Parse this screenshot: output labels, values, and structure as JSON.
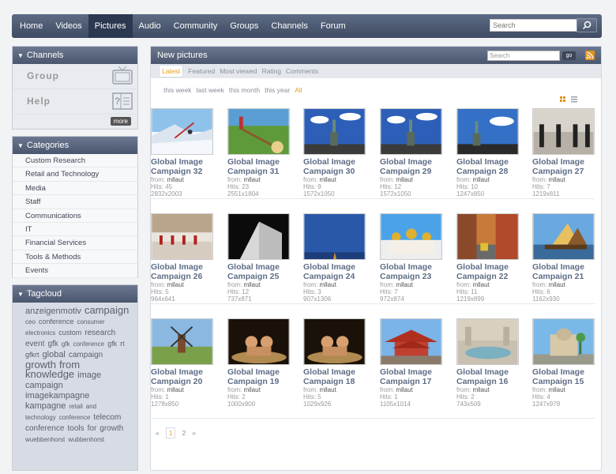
{
  "nav": {
    "items": [
      "Home",
      "Videos",
      "Pictures",
      "Audio",
      "Community",
      "Groups",
      "Channels",
      "Forum"
    ],
    "active": "Pictures",
    "search_placeholder": "Search"
  },
  "channels": {
    "title": "Channels",
    "items": [
      {
        "label": "Group",
        "icon": "tv-icon"
      },
      {
        "label": "Help",
        "icon": "help-icon"
      }
    ],
    "more_label": "more"
  },
  "categories": {
    "title": "Categories",
    "items": [
      "Custom Research",
      "Retail and Technology",
      "Media",
      "Staff",
      "Communications",
      "IT",
      "Financial Services",
      "Tools & Methods",
      "Events"
    ]
  },
  "tagcloud": {
    "title": "Tagcloud",
    "tags": [
      {
        "t": "anzeigenmotiv",
        "s": 11
      },
      {
        "t": "campaign",
        "s": 13
      },
      {
        "t": "ceo",
        "s": 8
      },
      {
        "t": "conference",
        "s": 9
      },
      {
        "t": "consumer",
        "s": 8
      },
      {
        "t": "electronics",
        "s": 8
      },
      {
        "t": "custom",
        "s": 9
      },
      {
        "t": "research",
        "s": 10
      },
      {
        "t": "event",
        "s": 10
      },
      {
        "t": "gfk",
        "s": 10
      },
      {
        "t": "gfk",
        "s": 8
      },
      {
        "t": "conference",
        "s": 8
      },
      {
        "t": "gfk",
        "s": 9
      },
      {
        "t": "rt",
        "s": 9
      },
      {
        "t": "gfkrt",
        "s": 9
      },
      {
        "t": "global",
        "s": 11
      },
      {
        "t": "campaign",
        "s": 10
      },
      {
        "t": "growth",
        "s": 13
      },
      {
        "t": "from",
        "s": 13
      },
      {
        "t": "knowledge",
        "s": 13
      },
      {
        "t": "image",
        "s": 11
      },
      {
        "t": "campaign",
        "s": 11
      },
      {
        "t": "imagekampagne",
        "s": 11
      },
      {
        "t": "kampagne",
        "s": 11
      },
      {
        "t": "retail",
        "s": 8
      },
      {
        "t": "and",
        "s": 8
      },
      {
        "t": "technology",
        "s": 8
      },
      {
        "t": "conference",
        "s": 8
      },
      {
        "t": "telecom",
        "s": 10
      },
      {
        "t": "conference",
        "s": 10
      },
      {
        "t": "tools",
        "s": 10
      },
      {
        "t": "for",
        "s": 10
      },
      {
        "t": "growth",
        "s": 10
      },
      {
        "t": "wuebbenhorst",
        "s": 8
      },
      {
        "t": "wubbenhorst",
        "s": 8
      }
    ]
  },
  "main": {
    "title": "New pictures",
    "search_placeholder": "Search",
    "go_label": "go",
    "tabs": [
      "Latest",
      "Featured",
      "Most viewed",
      "Rating",
      "Comments"
    ],
    "active_tab": "Latest",
    "filters": [
      "this week",
      "last week",
      "this month",
      "this year",
      "All"
    ],
    "active_filter": "All",
    "pictures": [
      {
        "title": "Global Image Campaign 32",
        "from": "mllaut",
        "hits": "45",
        "size": "2832x2003",
        "theme": "ski"
      },
      {
        "title": "Global Image Campaign 31",
        "from": "mllaut",
        "hits": "23",
        "size": "2551x1804",
        "theme": "alphorn"
      },
      {
        "title": "Global Image Campaign 30",
        "from": "mllaut",
        "hits": "9",
        "size": "1572x1050",
        "theme": "liberty"
      },
      {
        "title": "Global Image Campaign 29",
        "from": "mllaut",
        "hits": "12",
        "size": "1572x1050",
        "theme": "liberty"
      },
      {
        "title": "Global Image Campaign 28",
        "from": "mllaut",
        "hits": "10",
        "size": "1247x850",
        "theme": "liberty2"
      },
      {
        "title": "Global Image Campaign 27",
        "from": "mllaut",
        "hits": "7",
        "size": "1219x811",
        "theme": "guards"
      },
      {
        "title": "Global Image Campaign 26",
        "from": "mllaut",
        "hits": "5",
        "size": "964x641",
        "theme": "parade"
      },
      {
        "title": "Global Image Campaign 25",
        "from": "mllaut",
        "hits": "12",
        "size": "737x871",
        "theme": "building"
      },
      {
        "title": "Global Image Campaign 24",
        "from": "mllaut",
        "hits": "3",
        "size": "907x1306",
        "theme": "sky"
      },
      {
        "title": "Global Image Campaign 23",
        "from": "mllaut",
        "hits": "7",
        "size": "972x874",
        "theme": "kremlin"
      },
      {
        "title": "Global Image Campaign 22",
        "from": "mllaut",
        "hits": "11",
        "size": "1219x899",
        "theme": "street"
      },
      {
        "title": "Global Image Campaign 21",
        "from": "mllaut",
        "hits": "6",
        "size": "1162x930",
        "theme": "boat"
      },
      {
        "title": "Global Image Campaign 20",
        "from": "mllaut",
        "hits": "1",
        "size": "1278x850",
        "theme": "windmill"
      },
      {
        "title": "Global Image Campaign 19",
        "from": "mllaut",
        "hits": "2",
        "size": "1000x900",
        "theme": "sumo"
      },
      {
        "title": "Global Image Campaign 18",
        "from": "mllaut",
        "hits": "5",
        "size": "1029x926",
        "theme": "sumo"
      },
      {
        "title": "Global Image Campaign 17",
        "from": "mllaut",
        "hits": "1",
        "size": "1105x1014",
        "theme": "pagoda"
      },
      {
        "title": "Global Image Campaign 16",
        "from": "mllaut",
        "hits": "2",
        "size": "743x509",
        "theme": "fountain"
      },
      {
        "title": "Global Image Campaign 15",
        "from": "mllaut",
        "hits": "4",
        "size": "1247x978",
        "theme": "india"
      }
    ],
    "pager": {
      "prev": "«",
      "pages": [
        "1",
        "2"
      ],
      "current": "1",
      "next": "»"
    }
  }
}
